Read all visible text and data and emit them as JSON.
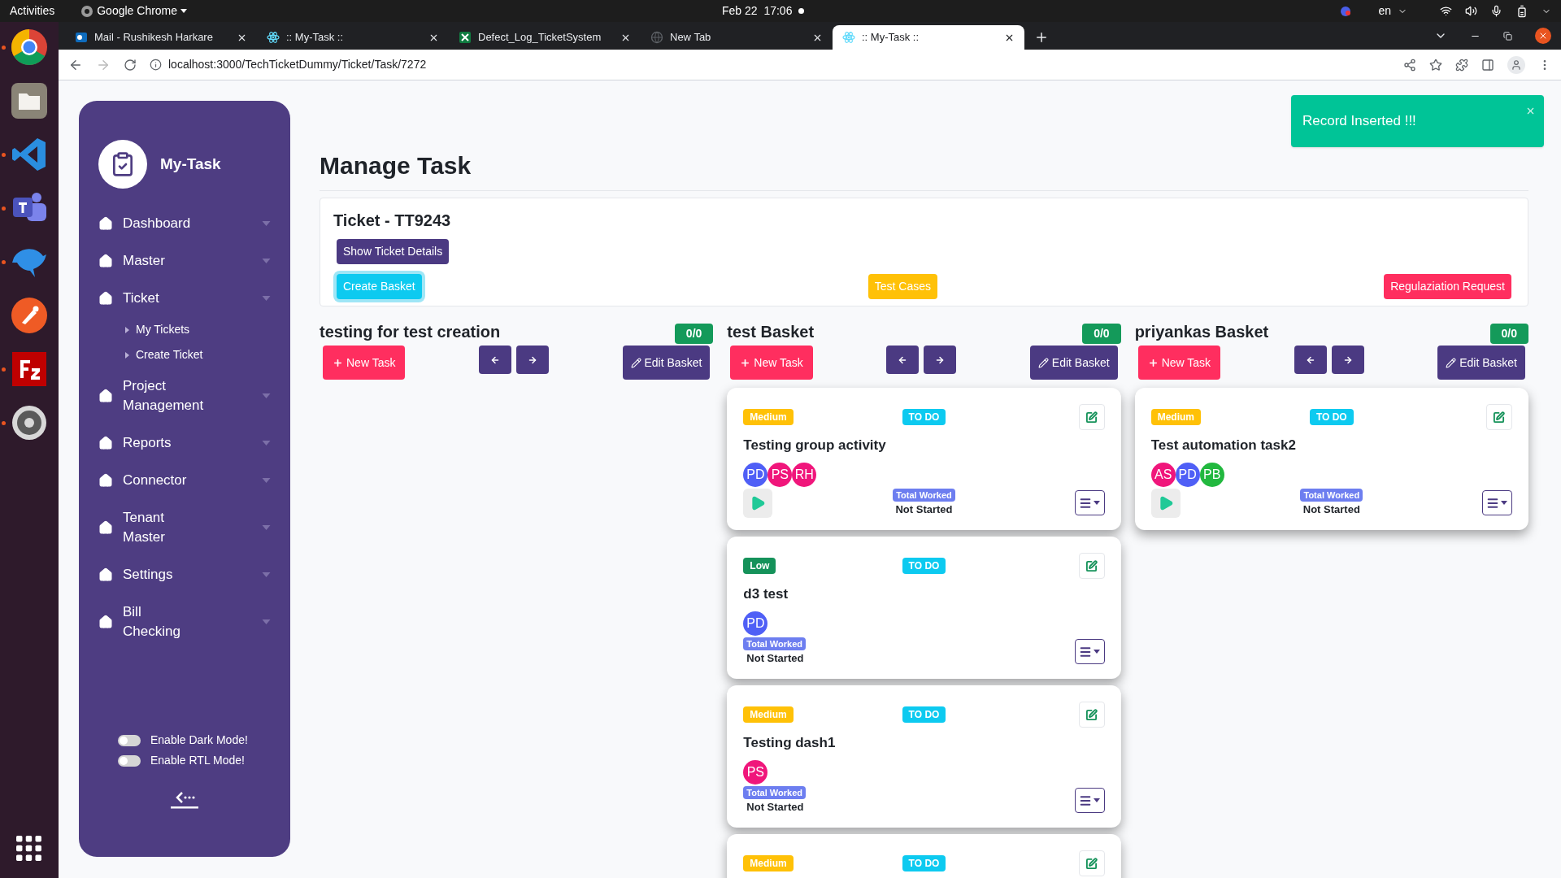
{
  "desktop_bar": {
    "activities": "Activities",
    "app_name": "Google Chrome",
    "clock": "Feb 22  17:06",
    "language": "en"
  },
  "dock": [
    {
      "kind": "chrome",
      "running": true
    },
    {
      "kind": "files",
      "running": false
    },
    {
      "kind": "code",
      "running": true
    },
    {
      "kind": "chat",
      "running": true
    },
    {
      "kind": "dolphin",
      "running": true
    },
    {
      "kind": "api",
      "running": false
    },
    {
      "kind": "ftp",
      "running": true
    },
    {
      "kind": "gear",
      "running": true
    }
  ],
  "browser": {
    "tabs": [
      {
        "title": "Mail - Rushikesh Harkare",
        "kind": "mail",
        "selected": false
      },
      {
        "title": ":: My-Task ::",
        "kind": "atom",
        "selected": false
      },
      {
        "title": "Defect_Log_TicketSystem",
        "kind": "sheet",
        "selected": false
      },
      {
        "title": "New Tab",
        "kind": "globe",
        "selected": false
      },
      {
        "title": ":: My-Task ::",
        "kind": "atom",
        "selected": true
      }
    ],
    "url": "localhost:3000/TechTicketDummy/Ticket/Task/7272"
  },
  "sidebar": {
    "brand": "My-Task",
    "items": [
      {
        "label": "Dashboard"
      },
      {
        "label": "Master"
      },
      {
        "label": "Ticket",
        "children": [
          {
            "label": "My Tickets"
          },
          {
            "label": "Create Ticket"
          }
        ]
      },
      {
        "label": "Project Management"
      },
      {
        "label": "Reports"
      },
      {
        "label": "Connector"
      },
      {
        "label": "Tenant Master"
      },
      {
        "label": "Settings"
      },
      {
        "label": "Bill Checking"
      }
    ],
    "toggles": [
      {
        "label": "Enable Dark Mode!",
        "on": false
      },
      {
        "label": "Enable RTL Mode!",
        "on": false
      }
    ]
  },
  "toast": {
    "message": "Record Inserted !!!"
  },
  "page": {
    "title": "Manage Task",
    "ticket": {
      "title": "Ticket - TT9243",
      "details_button": "Show Ticket Details",
      "actions": [
        {
          "label": "Create Basket",
          "kind": "info"
        },
        {
          "label": "Test Cases",
          "kind": "warning"
        },
        {
          "label": "Regulaziation Request",
          "kind": "danger"
        }
      ]
    }
  },
  "baskets": [
    {
      "name": "testing for test creation",
      "count": "0/0",
      "new_task": "New Task",
      "edit": "Edit Basket"
    },
    {
      "name": "test Basket",
      "count": "0/0",
      "new_task": "New Task",
      "edit": "Edit Basket",
      "tasks": [
        {
          "priority": "Medium",
          "kind": "medium",
          "status": "TO DO",
          "title": "Testing group activity",
          "assignees": [
            {
              "initials": "PD",
              "color": "#4f5ff6"
            },
            {
              "initials": "PS",
              "color": "#f0167b"
            },
            {
              "initials": "RH",
              "color": "#f0167b"
            }
          ],
          "total_worked": "Total Worked",
          "time": "Not Started",
          "timer": true
        },
        {
          "priority": "Low",
          "kind": "low",
          "status": "TO DO",
          "title": "d3 test",
          "assignees": [
            {
              "initials": "PD",
              "color": "#4f5ff6"
            }
          ],
          "total_worked": "Total Worked",
          "time": "Not Started",
          "timer": false
        },
        {
          "priority": "Medium",
          "kind": "medium",
          "status": "TO DO",
          "title": "Testing dash1",
          "assignees": [
            {
              "initials": "PS",
              "color": "#f0167b"
            }
          ],
          "total_worked": "Total Worked",
          "time": "Not Started",
          "timer": false
        },
        {
          "priority": "Medium",
          "kind": "medium",
          "status": "TO DO"
        }
      ]
    },
    {
      "name": "priyankas Basket",
      "count": "0/0",
      "new_task": "New Task",
      "edit": "Edit Basket",
      "tasks": [
        {
          "priority": "Medium",
          "kind": "medium",
          "status": "TO DO",
          "title": "Test automation task2",
          "assignees": [
            {
              "initials": "AS",
              "color": "#f0167b"
            },
            {
              "initials": "PD",
              "color": "#4f5ff6"
            },
            {
              "initials": "PB",
              "color": "#22b83f"
            }
          ],
          "total_worked": "Total Worked",
          "time": "Not Started",
          "timer": true
        }
      ]
    }
  ]
}
